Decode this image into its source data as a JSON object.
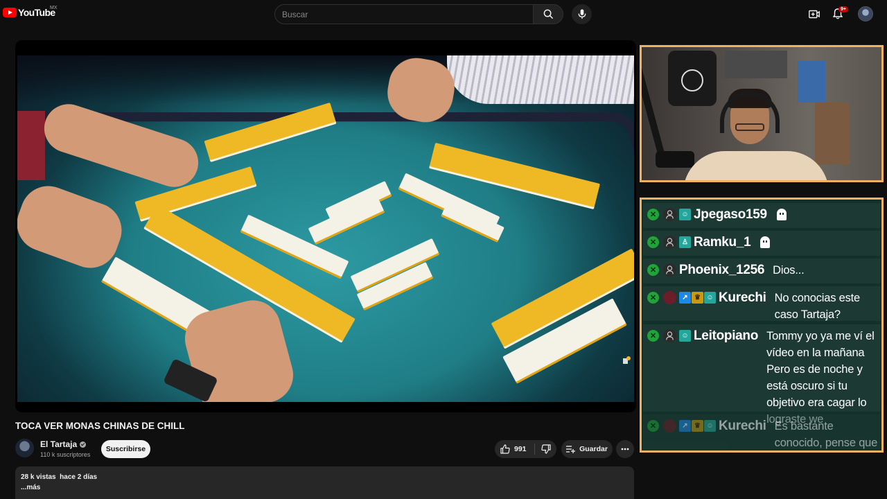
{
  "header": {
    "logo_text": "YouTube",
    "region": "MX",
    "search_placeholder": "Buscar",
    "notification_badge": "9+",
    "icons": [
      "search-icon",
      "mic-icon",
      "create-icon",
      "bell-icon",
      "avatar"
    ]
  },
  "video": {
    "title": "TOCA VER MONAS CHINAS DE CHILL",
    "channel": "El Tartaja",
    "subscribers": "110 k suscriptores",
    "subscribe_label": "Suscribirse",
    "likes": "991",
    "save_label": "Guardar",
    "views": "28 k vistas",
    "date": "hace 2 días",
    "more_label": "...más"
  },
  "chat": {
    "messages": [
      {
        "user": "Jpegaso159",
        "badges": [
          "teal"
        ],
        "text": "",
        "emote": "ghost-emote"
      },
      {
        "user": "Ramku_1",
        "badges": [
          "teal"
        ],
        "text": "",
        "emote": "ghost-emote"
      },
      {
        "user": "Phoenix_1256",
        "badges": [],
        "text": "Dios..."
      },
      {
        "user": "Kurechi",
        "badges": [
          "blue",
          "gold",
          "teal"
        ],
        "text": "No conocias este caso Tartaja?"
      },
      {
        "user": "Leitopiano",
        "badges": [
          "teal"
        ],
        "text": "Tommy yo ya me ví el vídeo en la mañana Pero es de noche y está oscuro si tu objetivo era cagar lo lograste we"
      },
      {
        "user": "Kurechi",
        "badges": [
          "blue",
          "gold",
          "teal"
        ],
        "text": "Es bastante conocido, pense que ya lo sabias"
      }
    ]
  },
  "colors": {
    "background": "#0f0f0f",
    "overlay_border": "#f2b062",
    "chat_bg": "#12312a",
    "youtube_red": "#ff0000"
  }
}
